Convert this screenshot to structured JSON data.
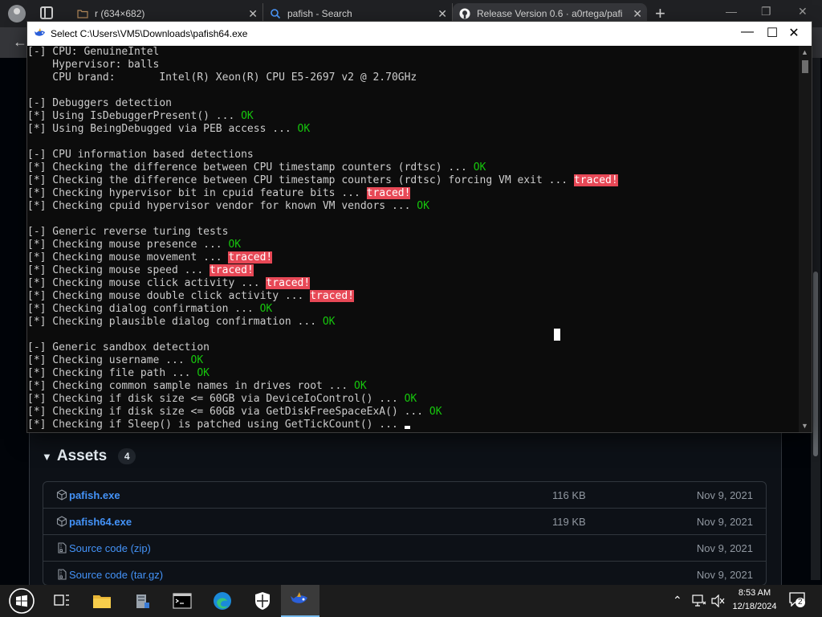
{
  "browser": {
    "tabs": [
      {
        "title": "r (634×682)",
        "icon": "folder-icon"
      },
      {
        "title": "pafish - Search",
        "icon": "search-icon"
      },
      {
        "title": "Release Version 0.6 · a0rtega/pafi",
        "icon": "github-icon"
      }
    ],
    "new_tab_label": "+",
    "minimize_label": "—",
    "restore_label": "❐",
    "close_label": "✕"
  },
  "console": {
    "title": "Select C:\\Users\\VM5\\Downloads\\pafish64.exe",
    "minimize": "—",
    "maximize": "☐",
    "close": "✕",
    "lines": [
      {
        "text": "[-] CPU: GenuineIntel"
      },
      {
        "text": "    Hypervisor: balls"
      },
      {
        "text": "    CPU brand:       Intel(R) Xeon(R) CPU E5-2697 v2 @ 2.70GHz"
      },
      {
        "text": ""
      },
      {
        "text": "[-] Debuggers detection"
      },
      {
        "text": "[*] Using IsDebuggerPresent() ... ",
        "ok": "OK"
      },
      {
        "text": "[*] Using BeingDebugged via PEB access ... ",
        "ok": "OK"
      },
      {
        "text": ""
      },
      {
        "text": "[-] CPU information based detections"
      },
      {
        "text": "[*] Checking the difference between CPU timestamp counters (rdtsc) ... ",
        "ok": "OK"
      },
      {
        "text": "[*] Checking the difference between CPU timestamp counters (rdtsc) forcing VM exit ... ",
        "traced": "traced!"
      },
      {
        "text": "[*] Checking hypervisor bit in cpuid feature bits ... ",
        "traced": "traced!"
      },
      {
        "text": "[*] Checking cpuid hypervisor vendor for known VM vendors ... ",
        "ok": "OK"
      },
      {
        "text": ""
      },
      {
        "text": "[-] Generic reverse turing tests"
      },
      {
        "text": "[*] Checking mouse presence ... ",
        "ok": "OK"
      },
      {
        "text": "[*] Checking mouse movement ... ",
        "traced": "traced!"
      },
      {
        "text": "[*] Checking mouse speed ... ",
        "traced": "traced!"
      },
      {
        "text": "[*] Checking mouse click activity ... ",
        "traced": "traced!"
      },
      {
        "text": "[*] Checking mouse double click activity ... ",
        "traced": "traced!"
      },
      {
        "text": "[*] Checking dialog confirmation ... ",
        "ok": "OK"
      },
      {
        "text": "[*] Checking plausible dialog confirmation ... ",
        "ok": "OK"
      },
      {
        "text": ""
      },
      {
        "text": "[-] Generic sandbox detection"
      },
      {
        "text": "[*] Checking username ... ",
        "ok": "OK"
      },
      {
        "text": "[*] Checking file path ... ",
        "ok": "OK"
      },
      {
        "text": "[*] Checking common sample names in drives root ... ",
        "ok": "OK"
      },
      {
        "text": "[*] Checking if disk size <= 60GB via DeviceIoControl() ... ",
        "ok": "OK"
      },
      {
        "text": "[*] Checking if disk size <= 60GB via GetDiskFreeSpaceExA() ... ",
        "ok": "OK"
      },
      {
        "text": "[*] Checking if Sleep() is patched using GetTickCount() ... ",
        "cursor": true
      }
    ]
  },
  "release": {
    "assets_title": "Assets",
    "assets_count": "4",
    "assets": [
      {
        "name": "pafish.exe",
        "size": "116 KB",
        "date": "Nov 9, 2021",
        "icon": "package-icon",
        "bold": true
      },
      {
        "name": "pafish64.exe",
        "size": "119 KB",
        "date": "Nov 9, 2021",
        "icon": "package-icon",
        "bold": true
      },
      {
        "name": "Source code (zip)",
        "size": "",
        "date": "Nov 9, 2021",
        "icon": "file-zip-icon",
        "bold": false
      },
      {
        "name": "Source code (tar.gz)",
        "size": "",
        "date": "Nov 9, 2021",
        "icon": "file-zip-icon",
        "bold": false
      }
    ]
  },
  "taskbar": {
    "apps": [
      "task-view-icon",
      "file-explorer-icon",
      "server-manager-icon",
      "command-prompt-icon",
      "edge-icon",
      "windows-security-icon",
      "pafish-icon"
    ],
    "time": "8:53 AM",
    "date": "12/18/2024",
    "notification_count": "2",
    "colors": {
      "accent": "#76b9ed",
      "ok": "#16c60c",
      "traced_bg": "#e74856",
      "link": "#4493f8"
    }
  }
}
